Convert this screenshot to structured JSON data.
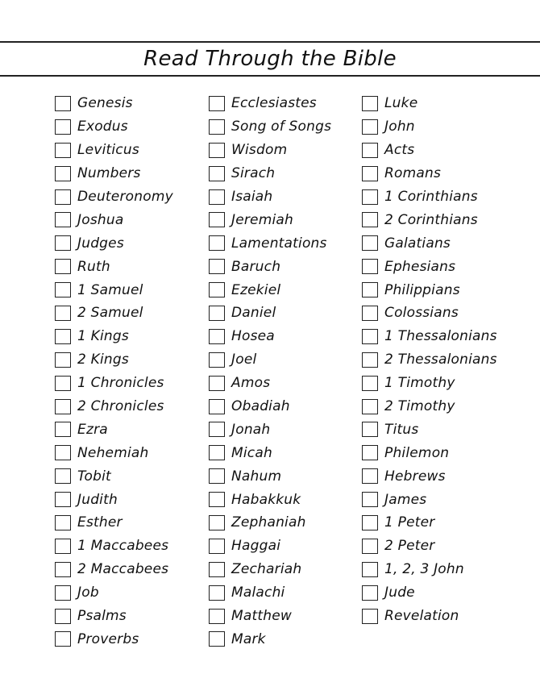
{
  "title": "Read Through the Bible",
  "columns": [
    [
      "Genesis",
      "Exodus",
      "Leviticus",
      "Numbers",
      "Deuteronomy",
      "Joshua",
      "Judges",
      "Ruth",
      "1 Samuel",
      "2 Samuel",
      "1 Kings",
      "2 Kings",
      "1 Chronicles",
      "2 Chronicles",
      "Ezra",
      "Nehemiah",
      "Tobit",
      "Judith",
      "Esther",
      "1 Maccabees",
      "2 Maccabees",
      "Job",
      "Psalms",
      "Proverbs"
    ],
    [
      "Ecclesiastes",
      "Song of Songs",
      "Wisdom",
      "Sirach",
      "Isaiah",
      "Jeremiah",
      "Lamentations",
      "Baruch",
      "Ezekiel",
      "Daniel",
      "Hosea",
      "Joel",
      "Amos",
      "Obadiah",
      "Jonah",
      "Micah",
      "Nahum",
      "Habakkuk",
      "Zephaniah",
      "Haggai",
      "Zechariah",
      "Malachi",
      "Matthew",
      "Mark"
    ],
    [
      "Luke",
      "John",
      "Acts",
      "Romans",
      "1 Corinthians",
      "2 Corinthians",
      "Galatians",
      "Ephesians",
      "Philippians",
      "Colossians",
      "1 Thessalonians",
      "2 Thessalonians",
      "1 Timothy",
      "2 Timothy",
      "Titus",
      "Philemon",
      "Hebrews",
      "James",
      "1 Peter",
      "2 Peter",
      "1, 2, 3 John",
      "Jude",
      "Revelation"
    ]
  ]
}
